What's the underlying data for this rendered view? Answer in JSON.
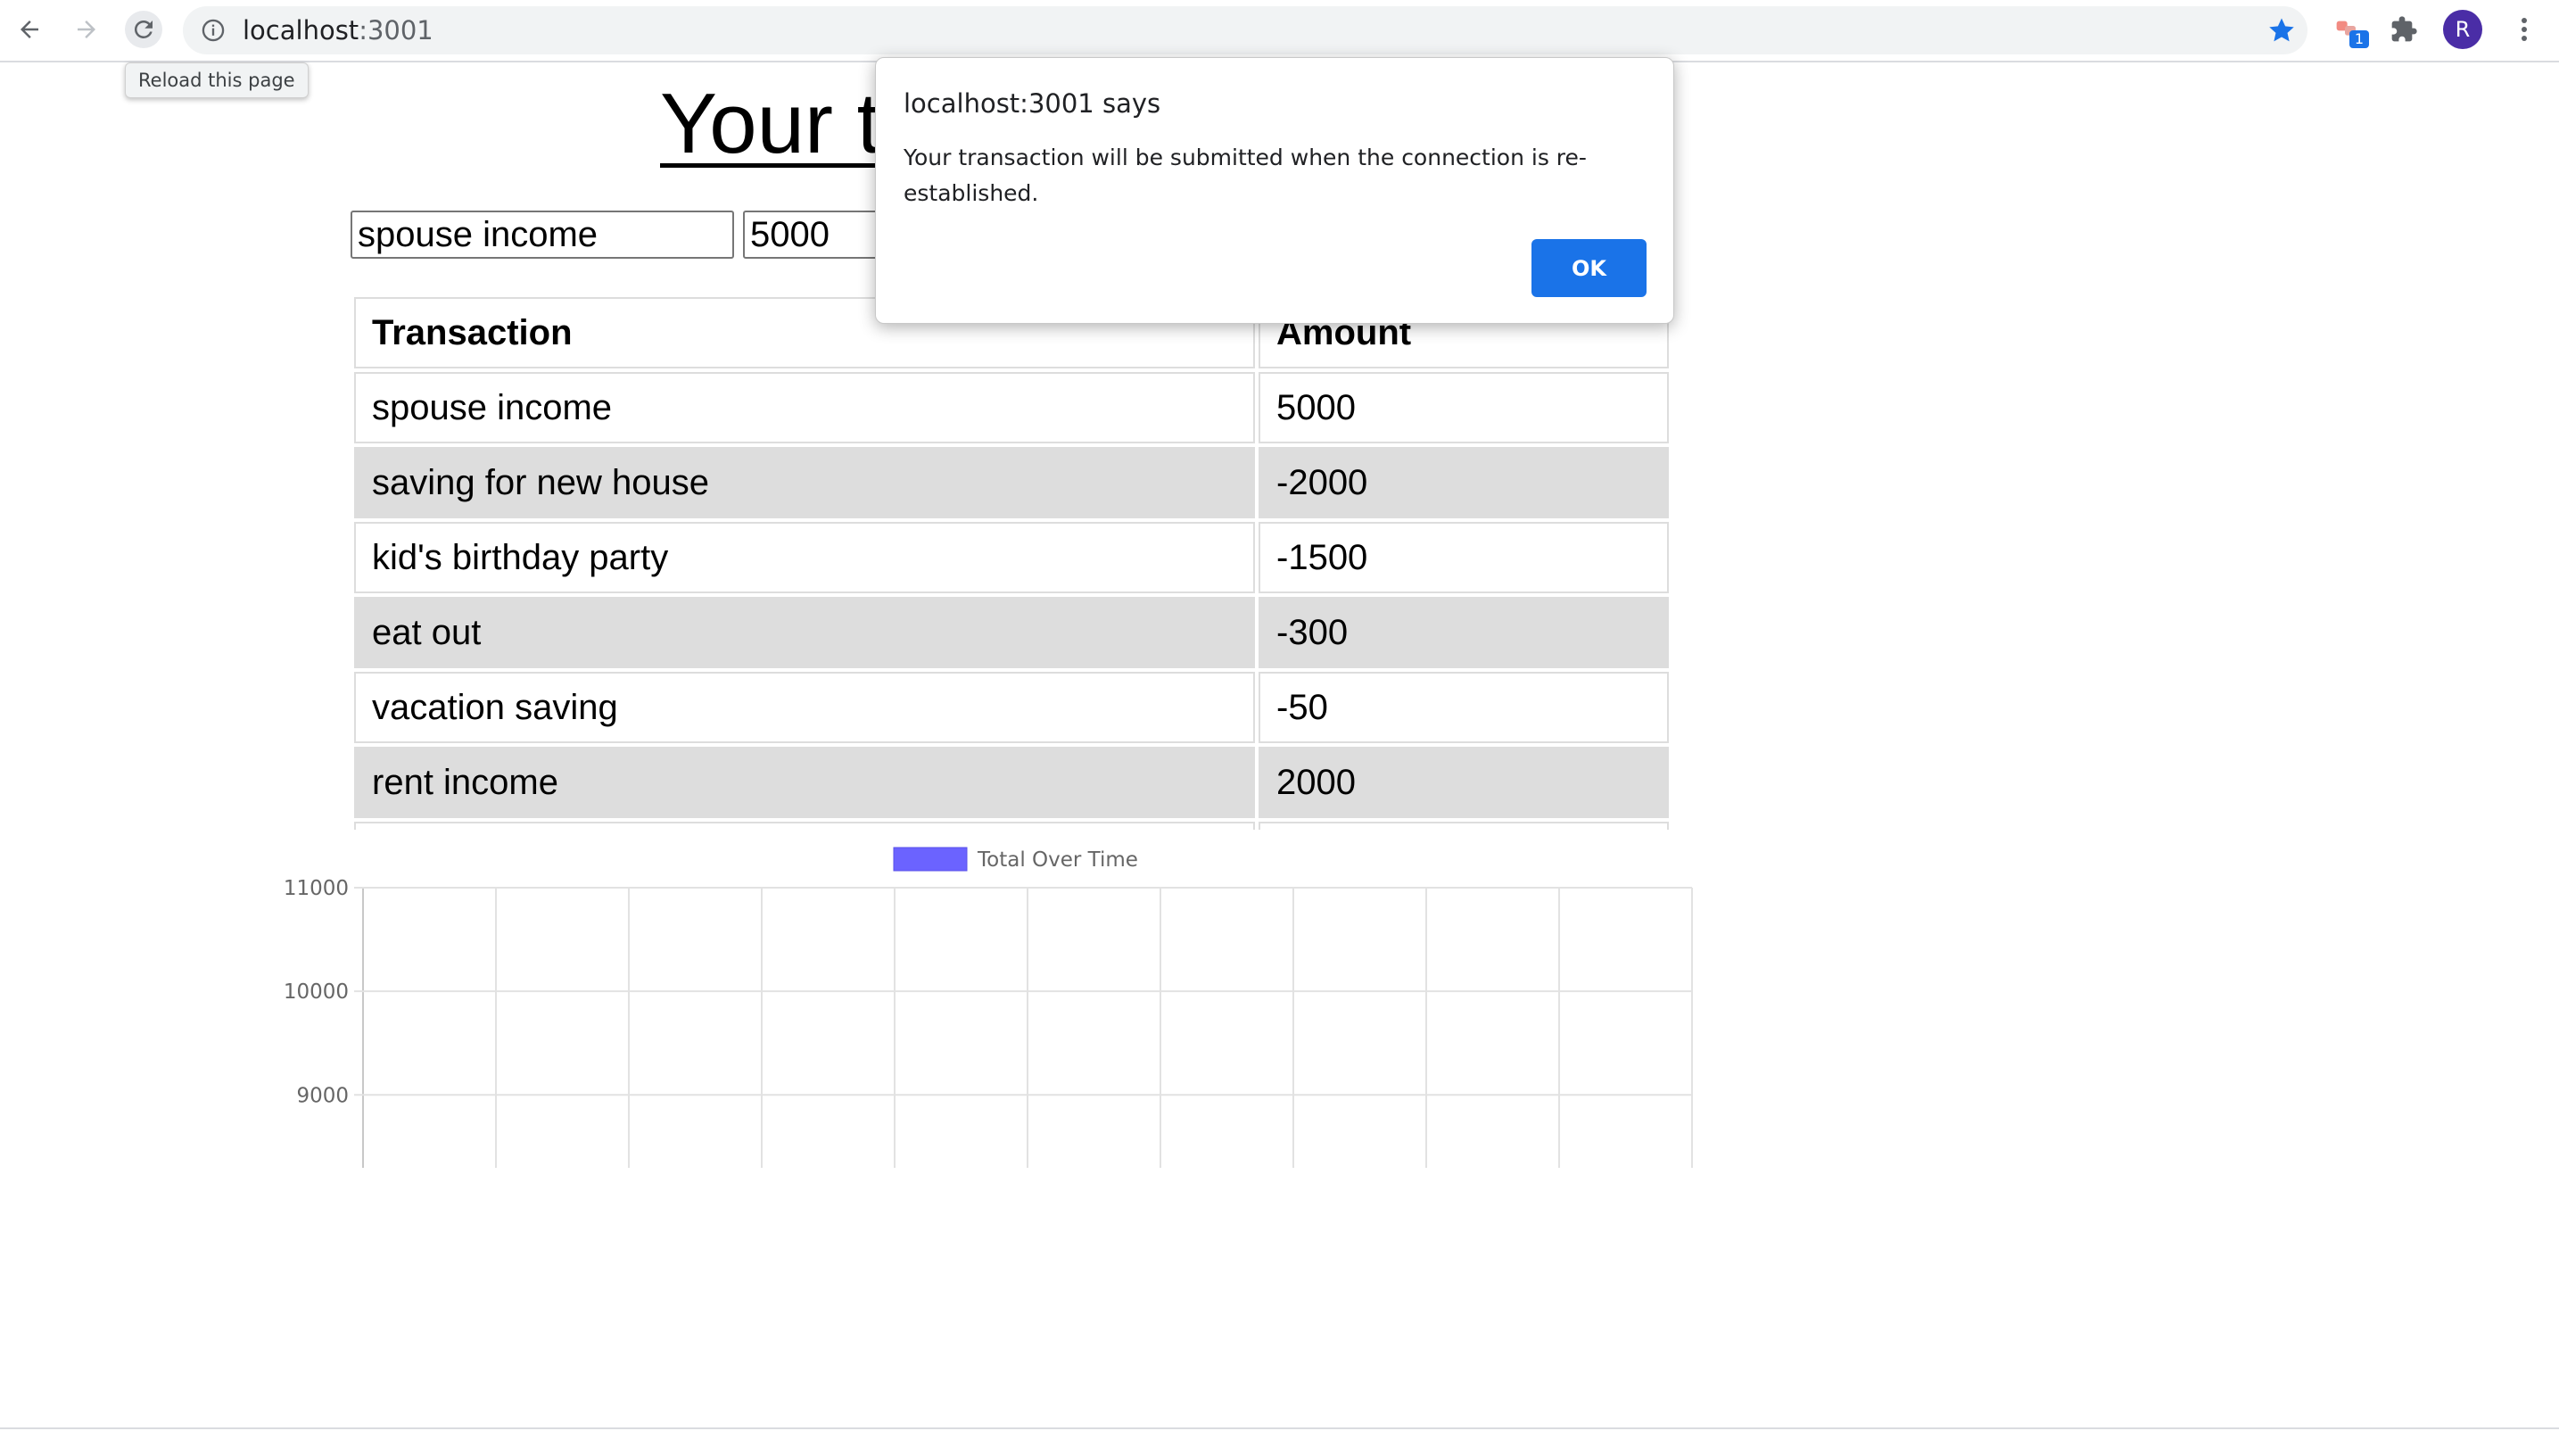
{
  "browser": {
    "url_host": "localhost",
    "url_port": ":3001",
    "tooltip": "Reload this page",
    "extension_badge": "1",
    "avatar_letter": "R",
    "icons": [
      "back-arrow-icon",
      "forward-arrow-icon",
      "reload-icon",
      "info-icon",
      "star-icon",
      "extension-icon",
      "puzzle-icon",
      "menu-dots-icon"
    ],
    "accent_color": "#1a73e8"
  },
  "page": {
    "title_visible": "Your t",
    "name_input_value": "spouse income",
    "amount_input_value": "5000",
    "table": {
      "headers": [
        "Transaction",
        "Amount"
      ],
      "rows": [
        {
          "name": "spouse income",
          "amount": "5000"
        },
        {
          "name": "saving for new house",
          "amount": "-2000"
        },
        {
          "name": "kid's birthday party",
          "amount": "-1500"
        },
        {
          "name": "eat out",
          "amount": "-300"
        },
        {
          "name": "vacation saving",
          "amount": "-50"
        },
        {
          "name": "rent income",
          "amount": "2000"
        }
      ],
      "stripe_color": "#dddddd"
    }
  },
  "chart_data": {
    "type": "line",
    "legend": [
      "Total Over Time"
    ],
    "legend_color": "#6b63ff",
    "legend_position": "top-center",
    "yticks": [
      11000,
      10000,
      9000
    ],
    "ylim": [
      8400,
      11000
    ],
    "x_gridlines": 10,
    "grid": true,
    "series": [
      {
        "name": "Total Over Time",
        "values": []
      }
    ]
  },
  "dialog": {
    "title": "localhost:3001 says",
    "message": "Your transaction will be submitted when the connection is re-established.",
    "ok_label": "OK"
  }
}
